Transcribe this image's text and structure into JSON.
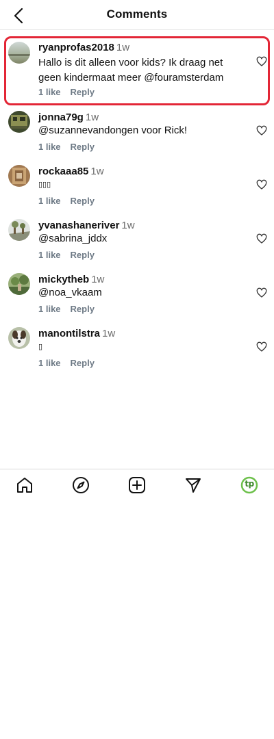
{
  "header": {
    "title": "Comments",
    "back_icon": "chevron-left-icon"
  },
  "comments": [
    {
      "username": "ryanprofas2018",
      "time": "1w",
      "text": "Hallo is dit alleen voor kids? Ik draag net geen kindermaat meer @fouramsterdam",
      "likes": "1 like",
      "reply": "Reply",
      "highlighted": true
    },
    {
      "username": "jonna79g",
      "time": "1w",
      "text": "@suzannevandongen voor Rick!",
      "likes": "1 like",
      "reply": "Reply"
    },
    {
      "username": "rockaaa85",
      "time": "1w",
      "text": "▯▯▯",
      "likes": "1 like",
      "reply": "Reply"
    },
    {
      "username": "yvanashaneriver",
      "time": "1w",
      "text": "@sabrina_jddx",
      "likes": "1 like",
      "reply": "Reply"
    },
    {
      "username": "mickytheb",
      "time": "1w",
      "text": "@noa_vkaam",
      "likes": "1 like",
      "reply": "Reply"
    },
    {
      "username": "manontilstra",
      "time": "1w",
      "text": "▯",
      "likes": "1 like",
      "reply": "Reply"
    }
  ],
  "bottom_nav": {
    "items": [
      "home-icon",
      "explore-compass-icon",
      "new-post-icon",
      "direct-message-icon",
      "profile-avatar"
    ],
    "profile_text": "tp",
    "profile_color": "#6cc04a"
  },
  "colors": {
    "highlight": "#e32636",
    "secondary_text": "#6e7a86"
  }
}
